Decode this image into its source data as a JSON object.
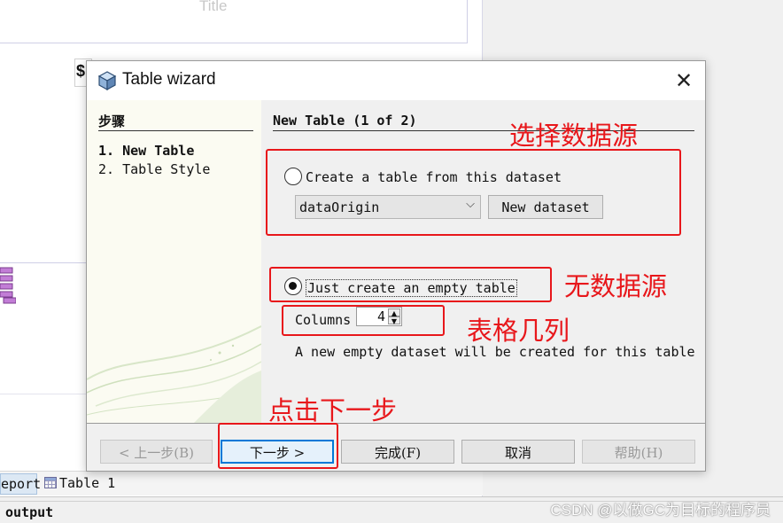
{
  "background": {
    "editor_title": "Title",
    "field_symbol": "$",
    "tabs": [
      "eport",
      "Table 1"
    ],
    "output_label": "output",
    "watermark": "CSDN @以做GC为目标的程序员"
  },
  "dialog": {
    "title": "Table wizard",
    "close_glyph": "✕",
    "steps": {
      "heading": "步骤",
      "items": [
        "1. New Table",
        "2. Table Style"
      ]
    },
    "content": {
      "heading": "New Table (1 of 2)",
      "option_dataset": {
        "label": "Create a table from this dataset",
        "selected": false,
        "dataset_value": "dataOrigin",
        "new_dataset_label": "New dataset"
      },
      "option_empty": {
        "label": "Just create an empty table",
        "selected": true,
        "columns_label": "Columns",
        "columns_value": "4",
        "note": "A new empty dataset will be created for this table"
      }
    },
    "buttons": {
      "back": "< 上一步(B)",
      "next": "下一步 >",
      "finish": "完成(F)",
      "cancel": "取消",
      "help": "帮助(H)"
    }
  },
  "annotations": {
    "dataset": "选择数据源",
    "empty": "无数据源",
    "columns": "表格几列",
    "next": "点击下一步",
    "color": "#e8171b"
  }
}
